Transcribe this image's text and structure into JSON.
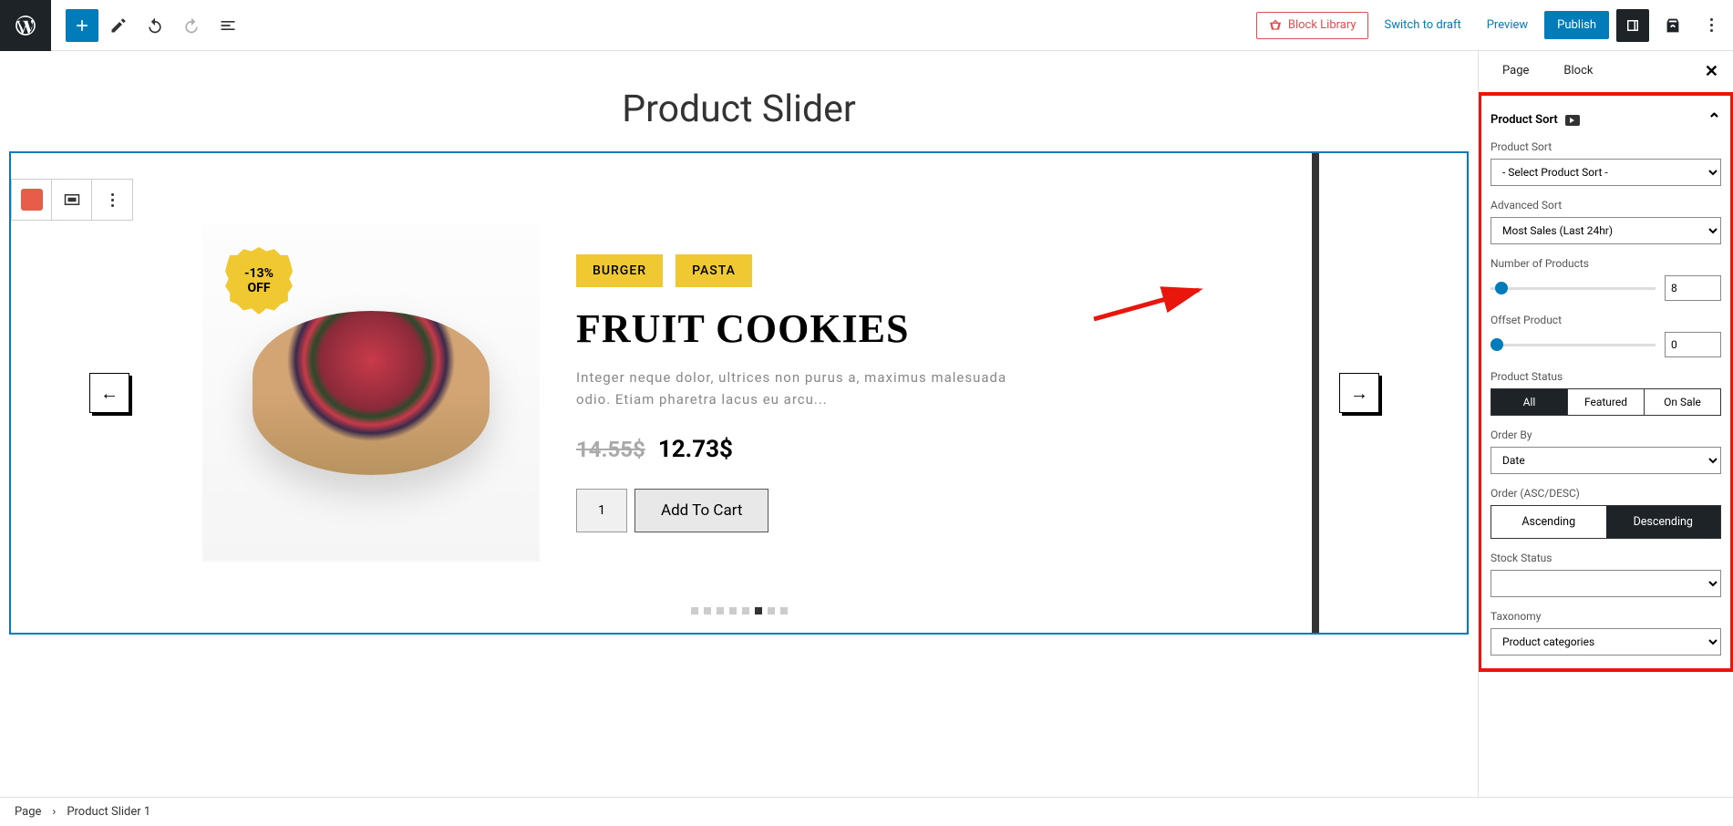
{
  "topbar": {
    "block_library": "Block Library",
    "switch_draft": "Switch to draft",
    "preview": "Preview",
    "publish": "Publish"
  },
  "page_title": "Product Slider",
  "product": {
    "badge_l1": "-13%",
    "badge_l2": "OFF",
    "tags": [
      "BURGER",
      "PASTA"
    ],
    "title": "FRUIT COOKIES",
    "desc": "Integer neque dolor, ultrices non purus a, maximus malesuada odio. Etiam pharetra lacus eu arcu...",
    "old_price": "14.55$",
    "new_price": "12.73$",
    "qty": "1",
    "atc": "Add To Cart"
  },
  "sidebar": {
    "tab_page": "Page",
    "tab_block": "Block",
    "section": "Product Sort",
    "product_sort": {
      "label": "Product Sort",
      "value": "- Select Product Sort -"
    },
    "advanced_sort": {
      "label": "Advanced Sort",
      "value": "Most Sales (Last 24hr)"
    },
    "num_products": {
      "label": "Number of Products",
      "value": "8"
    },
    "offset": {
      "label": "Offset Product",
      "value": "0"
    },
    "status": {
      "label": "Product Status",
      "all": "All",
      "featured": "Featured",
      "onsale": "On Sale"
    },
    "order_by": {
      "label": "Order By",
      "value": "Date"
    },
    "order": {
      "label": "Order (ASC/DESC)",
      "asc": "Ascending",
      "desc": "Descending"
    },
    "stock": {
      "label": "Stock Status"
    },
    "taxonomy": {
      "label": "Taxonomy",
      "value": "Product categories"
    }
  },
  "breadcrumb": {
    "page": "Page",
    "item": "Product Slider 1"
  }
}
